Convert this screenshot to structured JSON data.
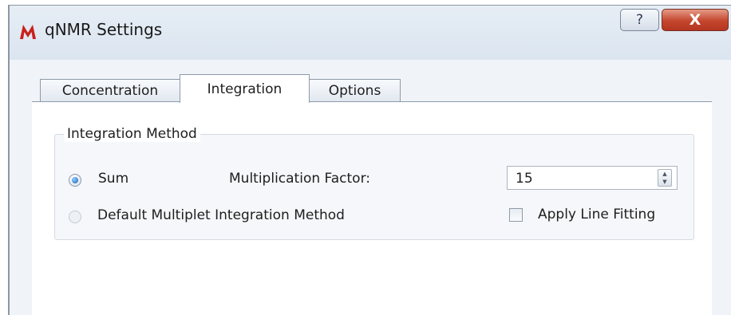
{
  "window": {
    "title": "qNMR Settings",
    "help_label": "?",
    "close_label": "X"
  },
  "tabs": [
    {
      "label": "Concentration",
      "selected": false
    },
    {
      "label": "Integration",
      "selected": true
    },
    {
      "label": "Options",
      "selected": false
    }
  ],
  "integration_method": {
    "group_title": "Integration Method",
    "sum_label": "Sum",
    "sum_checked": true,
    "default_label": "Default Multiplet Integration Method",
    "default_checked": false,
    "multiplication_factor_label": "Multiplication Factor:",
    "multiplication_factor_value": "15",
    "apply_line_fitting_label": "Apply Line Fitting",
    "apply_line_fitting_checked": false
  },
  "colors": {
    "title_bar": "#dbe5f0",
    "close_button": "#c4462e",
    "radio_selected": "#1a5fb4"
  },
  "icons": {
    "app": "acd-labs-logo-icon",
    "help": "help-icon",
    "close": "close-icon",
    "spin": "spin-up-down-icon"
  }
}
